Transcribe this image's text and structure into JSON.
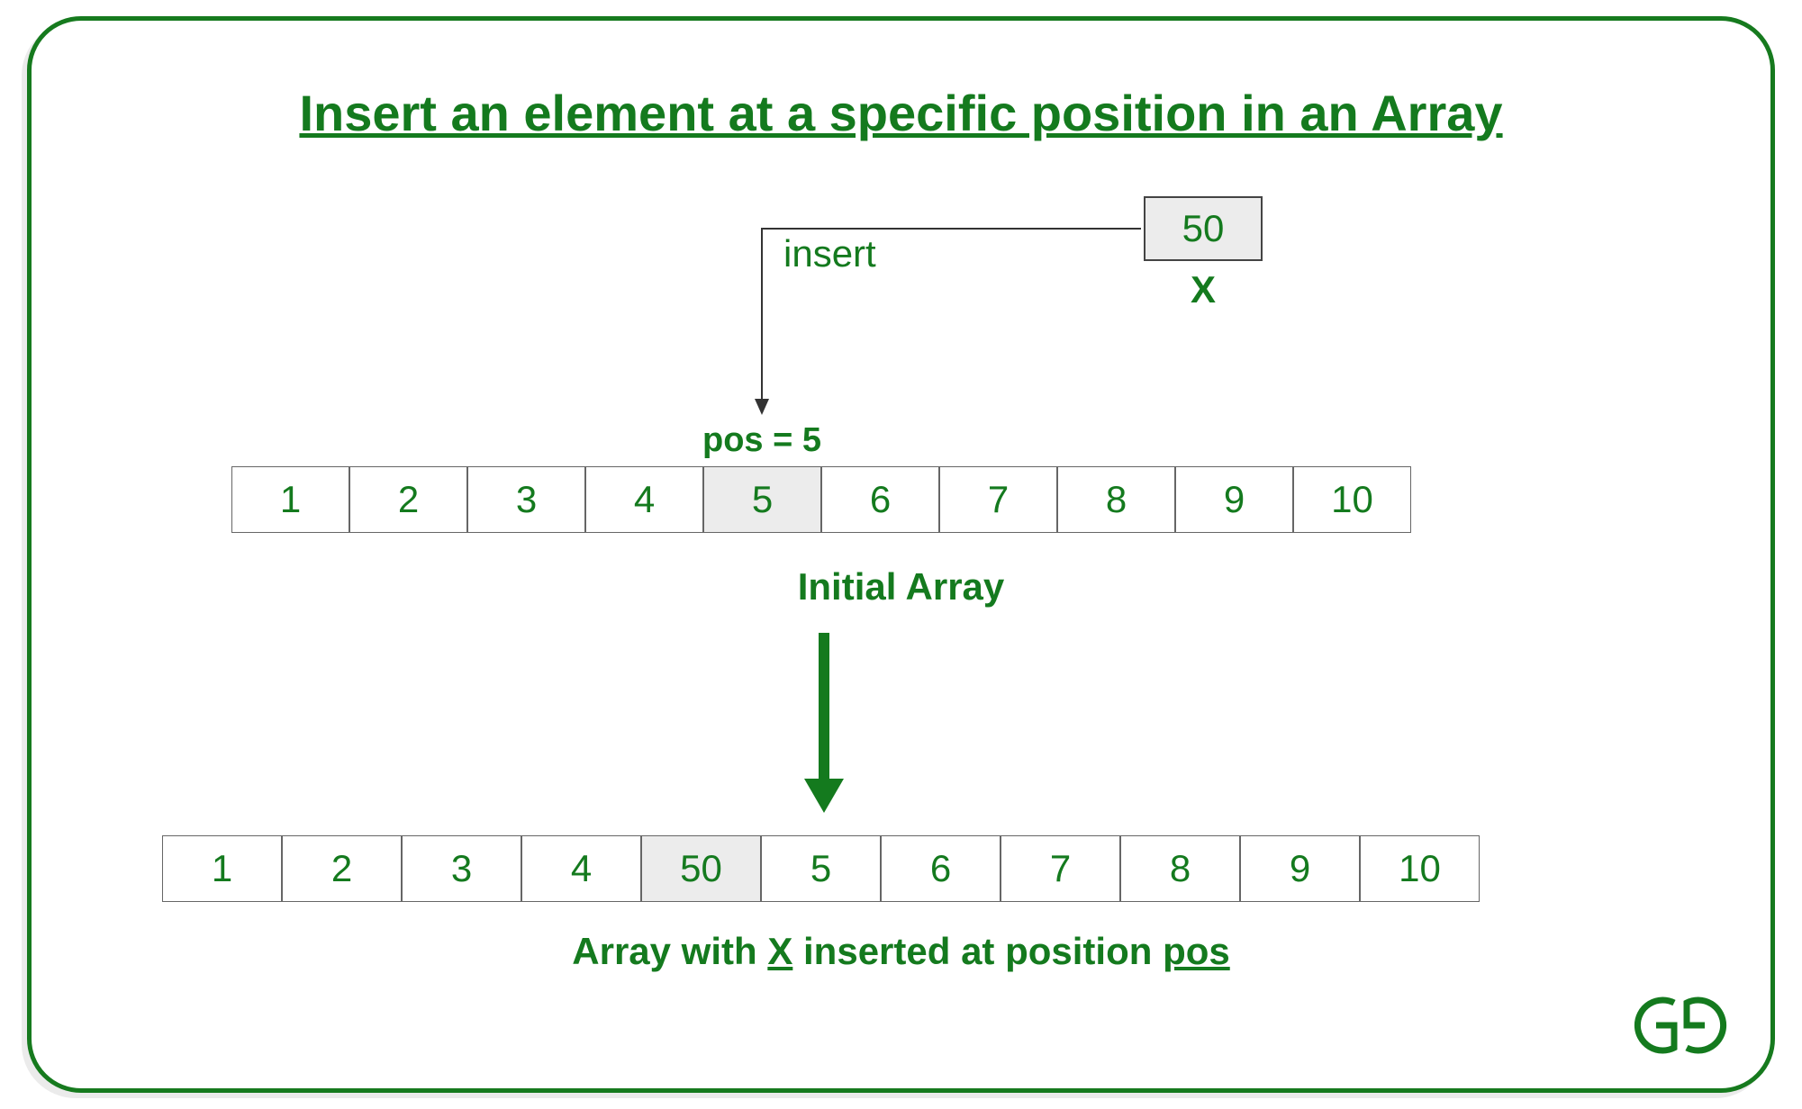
{
  "title": "Insert an element at a specific position in an Array",
  "insert_label": "insert",
  "x_value": "50",
  "x_label": "X",
  "pos_label": "pos = 5",
  "initial_array": [
    "1",
    "2",
    "3",
    "4",
    "5",
    "6",
    "7",
    "8",
    "9",
    "10"
  ],
  "initial_highlight_index": 4,
  "initial_array_label": "Initial Array",
  "result_array": [
    "1",
    "2",
    "3",
    "4",
    "50",
    "5",
    "6",
    "7",
    "8",
    "9",
    "10"
  ],
  "result_highlight_index": 4,
  "result_label_pre": "Array with ",
  "result_label_x": "X",
  "result_label_mid": " inserted at position ",
  "result_label_pos": "pos",
  "logo_text": "GG"
}
